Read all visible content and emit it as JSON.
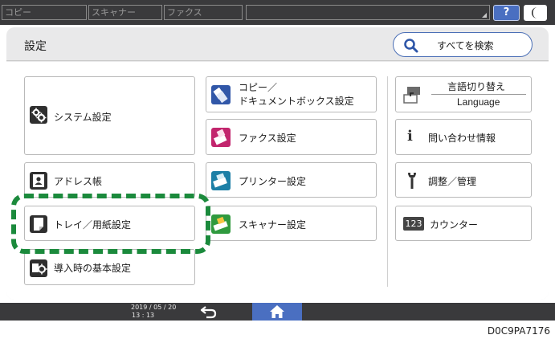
{
  "topbar": {
    "tabs": [
      "コピー",
      "スキャナー",
      "ファクス"
    ],
    "help_label": "?"
  },
  "header": {
    "title": "設定",
    "search_label": "すべてを検索"
  },
  "tiles": {
    "system": "システム設定",
    "copy_line1": "コピー／",
    "copy_line2": "ドキュメントボックス設定",
    "language_line1": "言語切り替え",
    "language_line2": "Language",
    "fax": "ファクス設定",
    "inquiry": "問い合わせ情報",
    "address": "アドレス帳",
    "printer": "プリンター設定",
    "adjust": "調整／管理",
    "tray": "トレイ／用紙設定",
    "scanner": "スキャナー設定",
    "counter": "カウンター",
    "counter_icon_text": "123",
    "initial": "導入時の基本設定"
  },
  "footer": {
    "date": "2019 / 05 / 20",
    "time": "13 : 13"
  },
  "caption": "D0C9PA7176",
  "colors": {
    "accent_blue": "#4a6fc1",
    "highlight_green": "#1b8a3c",
    "dark_bar": "#3a3a3c"
  },
  "icons": {
    "system": "gear-icon",
    "copy": "copy-icon",
    "language": "language-switch-icon",
    "fax": "fax-icon",
    "inquiry": "info-icon",
    "address": "address-book-icon",
    "printer": "printer-icon",
    "adjust": "wrench-icon",
    "tray": "paper-tray-icon",
    "scanner": "scanner-icon",
    "counter": "counter-icon",
    "initial": "initial-setup-icon"
  }
}
